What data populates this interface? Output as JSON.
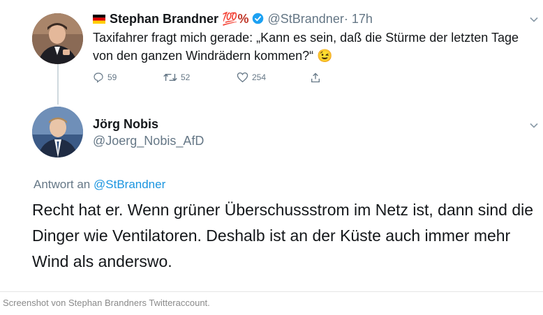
{
  "tweet1": {
    "author_name": "Stephan Brandner",
    "author_badge": "💯%",
    "handle": "@StBrandner",
    "time": "· 17h",
    "text": "Taxifahrer fragt mich gerade: „Kann es sein, daß die Stürme der letzten Tage von den ganzen Windrädern kommen?“",
    "emoji": "😉",
    "reply_count": "59",
    "retweet_count": "52",
    "like_count": "254"
  },
  "tweet2": {
    "author_name": "Jörg Nobis",
    "handle": "@Joerg_Nobis_AfD",
    "reply_prefix": "Antwort an",
    "reply_to": "@StBrandner",
    "text": "Recht hat er. Wenn grüner Überschussstrom im Netz ist, dann sind die Dinger wie Ventilatoren. Deshalb ist an der Küste auch immer mehr Wind als anderswo."
  },
  "caption": "Screenshot von Stephan Brandners Twitteraccount.",
  "icons": [
    "german-flag-icon",
    "verified-badge-icon",
    "chevron-down-icon",
    "reply-icon",
    "retweet-icon",
    "like-icon",
    "share-icon"
  ],
  "colors": {
    "verified": "#1da1f2",
    "link": "#1b95e0",
    "muted": "#657786"
  }
}
